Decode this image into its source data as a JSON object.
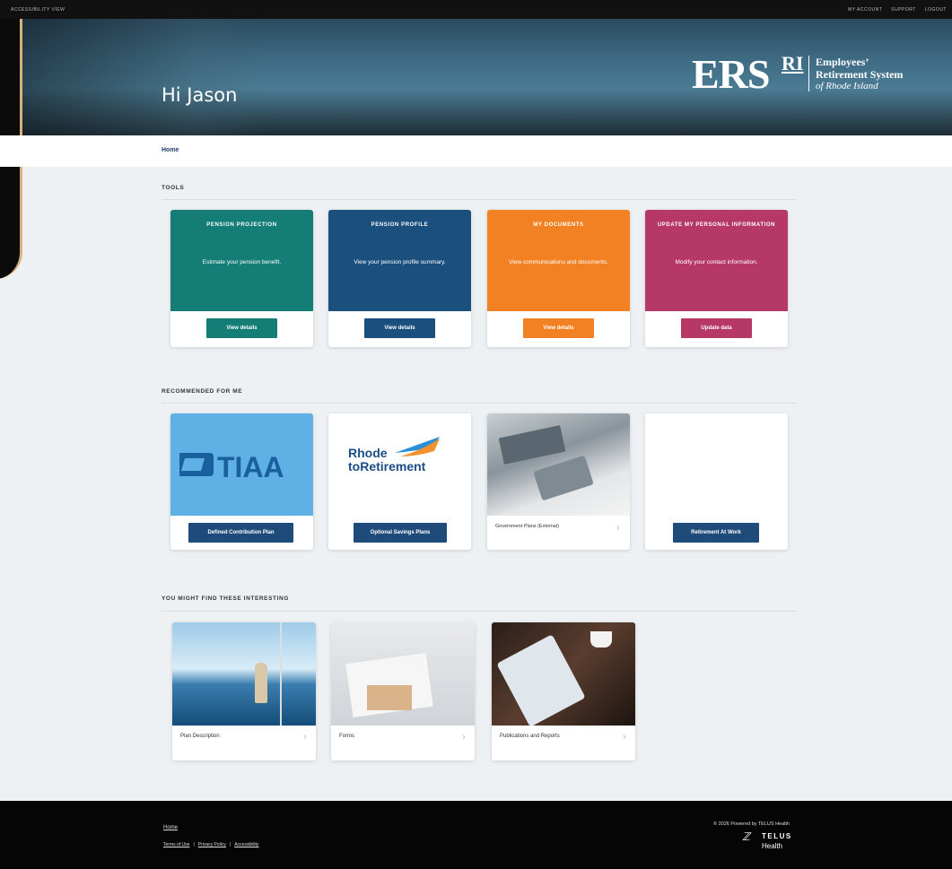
{
  "topbar": {
    "accessibility": "ACCESSIBILITY VIEW",
    "my_account": "MY ACCOUNT",
    "support": "SUPPORT",
    "logout": "LOGOUT"
  },
  "hero": {
    "greeting": "Hi Jason",
    "logo": {
      "ers": "ERS",
      "ri": "RI",
      "line1": "Employees’",
      "line2": "Retirement System",
      "line3": "of Rhode Island"
    }
  },
  "breadcrumb": {
    "home": "Home"
  },
  "tools": {
    "title": "TOOLS",
    "cards": [
      {
        "title": "PENSION PROJECTION",
        "desc": "Estimate your pension benefit.",
        "button": "View details",
        "color": "#137d76"
      },
      {
        "title": "PENSION PROFILE",
        "desc": "View your pension profile summary.",
        "button": "View details",
        "color": "#1b4f7d"
      },
      {
        "title": "MY DOCUMENTS",
        "desc": "View communications and documents.",
        "button": "View details",
        "color": "#f28123"
      },
      {
        "title": "UPDATE MY PERSONAL INFORMATION",
        "desc": "Modify your contact information.",
        "button": "Update data",
        "color": "#b63867"
      }
    ]
  },
  "recommended": {
    "title": "RECOMMENDED FOR ME",
    "cards": [
      {
        "logo": "TIAA",
        "button": "Defined Contribution Plan"
      },
      {
        "logo_line1": "Rhode",
        "logo_line2": "toRetirement",
        "button": "Optional Savings Plans"
      },
      {
        "link": "Government Plans (External)"
      },
      {
        "button": "Retirement At Work"
      }
    ]
  },
  "interesting": {
    "title": "YOU MIGHT FIND THESE INTERESTING",
    "cards": [
      {
        "label": "Plan Description"
      },
      {
        "label": "Forms"
      },
      {
        "label": "Publications and Reports"
      }
    ]
  },
  "footer": {
    "home": "Home",
    "terms": "Terms of Use",
    "privacy": "Privacy Policy",
    "accessibility": "Accessibility",
    "sep": "|",
    "powered": "© 2026 Powered by TELUS Health",
    "telus": "TELUS",
    "health": "Health"
  },
  "colors": {
    "navy": "#1e4b7a",
    "teal": "#137d76",
    "orange": "#f28123",
    "magenta": "#b63867"
  }
}
